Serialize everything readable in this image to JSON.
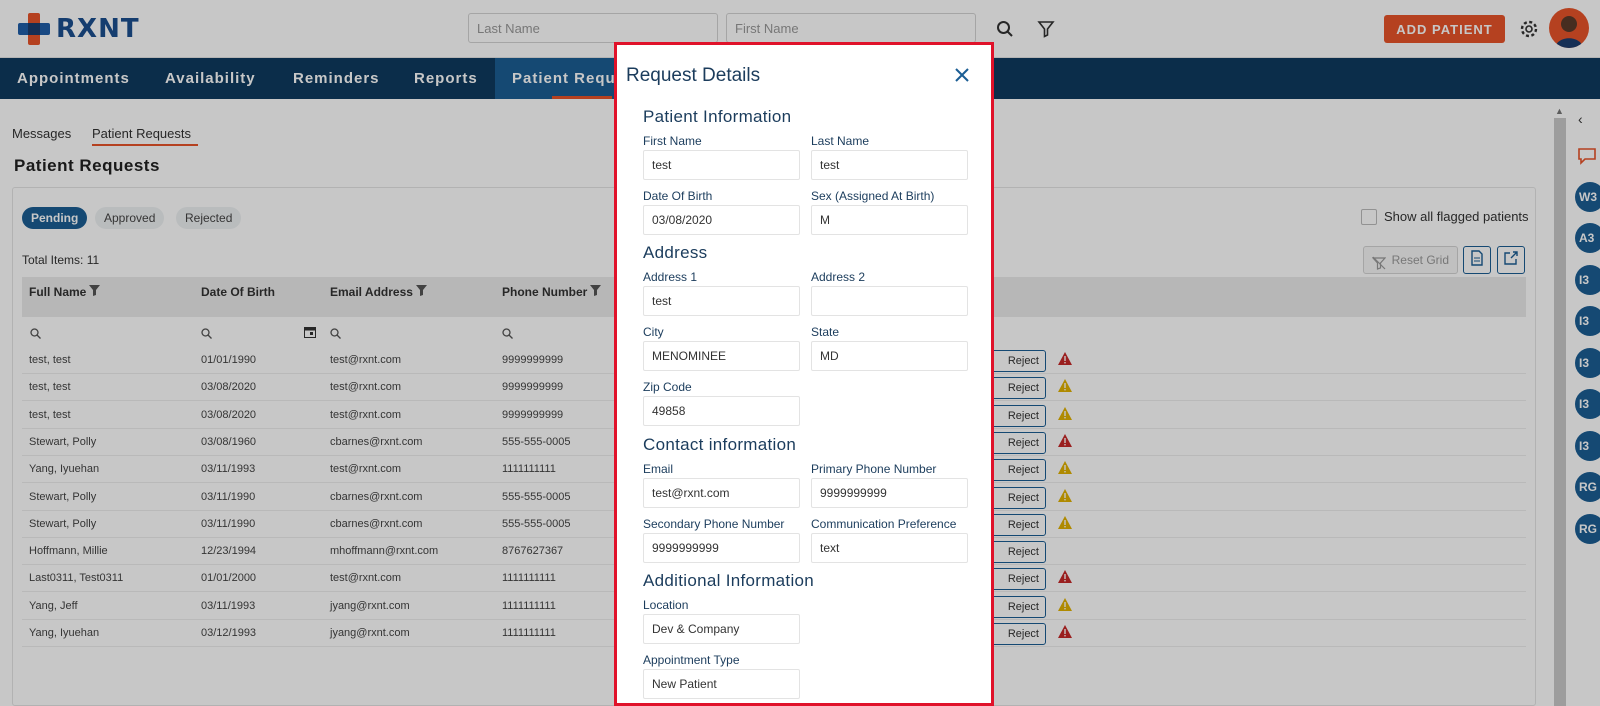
{
  "header": {
    "logo_text": "RXNT",
    "last_name_placeholder": "Last Name",
    "first_name_placeholder": "First Name",
    "add_patient_label": "ADD PATIENT",
    "brand_color": "#e8542a"
  },
  "nav": {
    "items": [
      {
        "label": "Appointments"
      },
      {
        "label": "Availability"
      },
      {
        "label": "Reminders"
      },
      {
        "label": "Reports"
      },
      {
        "label": "Patient Requ"
      }
    ],
    "active_index": 4,
    "bg_color": "#0f3a5f"
  },
  "subtabs": {
    "messages": "Messages",
    "patient_requests": "Patient Requests"
  },
  "page": {
    "title": "Patient Requests",
    "status_pills": [
      "Pending",
      "Approved",
      "Rejected"
    ],
    "active_pill": "Pending",
    "total_items": "Total Items: 11",
    "show_flagged_label": "Show all flagged patients",
    "reset_grid_label": "Reset Grid"
  },
  "grid": {
    "columns": [
      "Full Name",
      "Date Of Birth",
      "Email Address",
      "Phone Number"
    ],
    "reject_label": "Reject",
    "rows": [
      {
        "name": "test, test",
        "dob": "01/01/1990",
        "email": "test@rxnt.com",
        "phone": "9999999999",
        "flag": "red"
      },
      {
        "name": "test, test",
        "dob": "03/08/2020",
        "email": "test@rxnt.com",
        "phone": "9999999999",
        "flag": "yellow"
      },
      {
        "name": "test, test",
        "dob": "03/08/2020",
        "email": "test@rxnt.com",
        "phone": "9999999999",
        "flag": "yellow"
      },
      {
        "name": "Stewart, Polly",
        "dob": "03/08/1960",
        "email": "cbarnes@rxnt.com",
        "phone": "555-555-0005",
        "flag": "red"
      },
      {
        "name": "Yang, Iyuehan",
        "dob": "03/11/1993",
        "email": "test@rxnt.com",
        "phone": "1111111111",
        "flag": "yellow"
      },
      {
        "name": "Stewart, Polly",
        "dob": "03/11/1990",
        "email": "cbarnes@rxnt.com",
        "phone": "555-555-0005",
        "flag": "yellow"
      },
      {
        "name": "Stewart, Polly",
        "dob": "03/11/1990",
        "email": "cbarnes@rxnt.com",
        "phone": "555-555-0005",
        "flag": "yellow"
      },
      {
        "name": "Hoffmann, Millie",
        "dob": "12/23/1994",
        "email": "mhoffmann@rxnt.com",
        "phone": "8767627367",
        "flag": "none"
      },
      {
        "name": "Last0311, Test0311",
        "dob": "01/01/2000",
        "email": "test@rxnt.com",
        "phone": "1111111111",
        "flag": "red"
      },
      {
        "name": "Yang, Jeff",
        "dob": "03/11/1993",
        "email": "jyang@rxnt.com",
        "phone": "1111111111",
        "flag": "yellow"
      },
      {
        "name": "Yang, Iyuehan",
        "dob": "03/12/1993",
        "email": "jyang@rxnt.com",
        "phone": "1111111111",
        "flag": "red"
      }
    ]
  },
  "right_strip": {
    "chips": [
      "W3",
      "A3",
      "I3",
      "I3",
      "I3",
      "I3",
      "I3",
      "RG",
      "RG"
    ]
  },
  "modal": {
    "title": "Request Details",
    "sections": {
      "patient_info": "Patient Information",
      "address": "Address",
      "contact": "Contact information",
      "additional": "Additional Information"
    },
    "fields": {
      "first_name": {
        "label": "First Name",
        "value": "test"
      },
      "last_name": {
        "label": "Last Name",
        "value": "test"
      },
      "dob": {
        "label": "Date Of Birth",
        "value": "03/08/2020"
      },
      "sex": {
        "label": "Sex (Assigned At Birth)",
        "value": "M"
      },
      "address1": {
        "label": "Address 1",
        "value": "test"
      },
      "address2": {
        "label": "Address 2",
        "value": ""
      },
      "city": {
        "label": "City",
        "value": "MENOMINEE"
      },
      "state": {
        "label": "State",
        "value": "MD"
      },
      "zip": {
        "label": "Zip Code",
        "value": "49858"
      },
      "email": {
        "label": "Email",
        "value": "test@rxnt.com"
      },
      "primary_phone": {
        "label": "Primary Phone Number",
        "value": "9999999999"
      },
      "secondary_phone": {
        "label": "Secondary Phone Number",
        "value": "9999999999"
      },
      "comm_pref": {
        "label": "Communication Preference",
        "value": "text"
      },
      "location": {
        "label": "Location",
        "value": "Dev & Company"
      },
      "appointment_type": {
        "label": "Appointment Type",
        "value": "New Patient"
      }
    },
    "highlight_color": "#e0122a"
  }
}
